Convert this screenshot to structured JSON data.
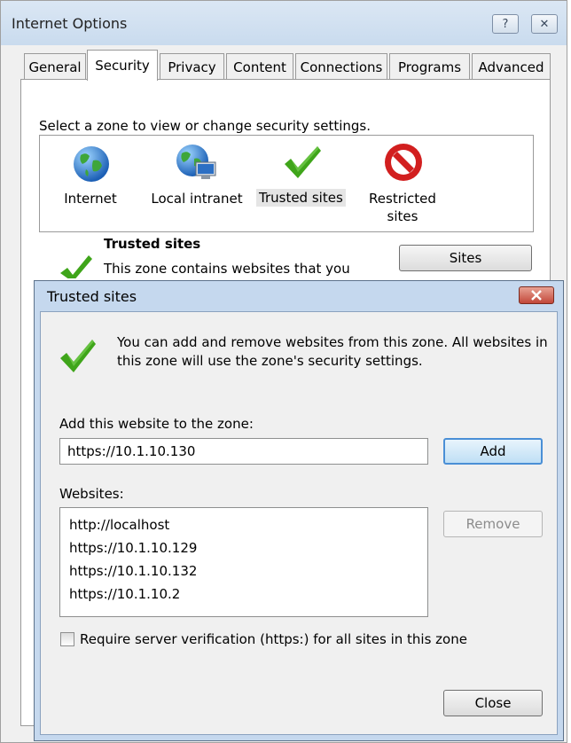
{
  "internet_options": {
    "title": "Internet Options",
    "titlebar_buttons": {
      "help": "?",
      "close": "✕"
    },
    "tabs": [
      {
        "label": "General"
      },
      {
        "label": "Security",
        "active": true
      },
      {
        "label": "Privacy"
      },
      {
        "label": "Content"
      },
      {
        "label": "Connections"
      },
      {
        "label": "Programs"
      },
      {
        "label": "Advanced"
      }
    ],
    "zone_prompt": "Select a zone to view or change security settings.",
    "zones": [
      {
        "label": "Internet",
        "icon": "globe-icon"
      },
      {
        "label": "Local intranet",
        "icon": "intranet-icon"
      },
      {
        "label": "Trusted sites",
        "icon": "checkmark-icon",
        "selected": true
      },
      {
        "label": "Restricted",
        "label2": "sites",
        "icon": "restricted-icon"
      }
    ],
    "selected_zone_heading": "Trusted sites",
    "selected_zone_description": "This zone contains websites that you",
    "sites_button": "Sites"
  },
  "trusted_sites_dialog": {
    "title": "Trusted sites",
    "intro": "You can add and remove websites from this zone. All websites in this zone will use the zone's security settings.",
    "add_label": "Add this website to the zone:",
    "url_value": "https://10.1.10.130",
    "add_button": "Add",
    "websites_label": "Websites:",
    "websites": [
      "http://localhost",
      "https://10.1.10.129",
      "https://10.1.10.132",
      "https://10.1.10.2"
    ],
    "remove_button": "Remove",
    "require_verification_label": "Require server verification (https:) for all sites in this zone",
    "require_verification_checked": false,
    "close_button": "Close"
  },
  "colors": {
    "window_bg": "#f0f0f0",
    "dialog_frame": "#c5d8ee",
    "accent_blue": "#4a8fd6",
    "check_green": "#3fa51a",
    "restricted_red": "#d21f1f"
  }
}
